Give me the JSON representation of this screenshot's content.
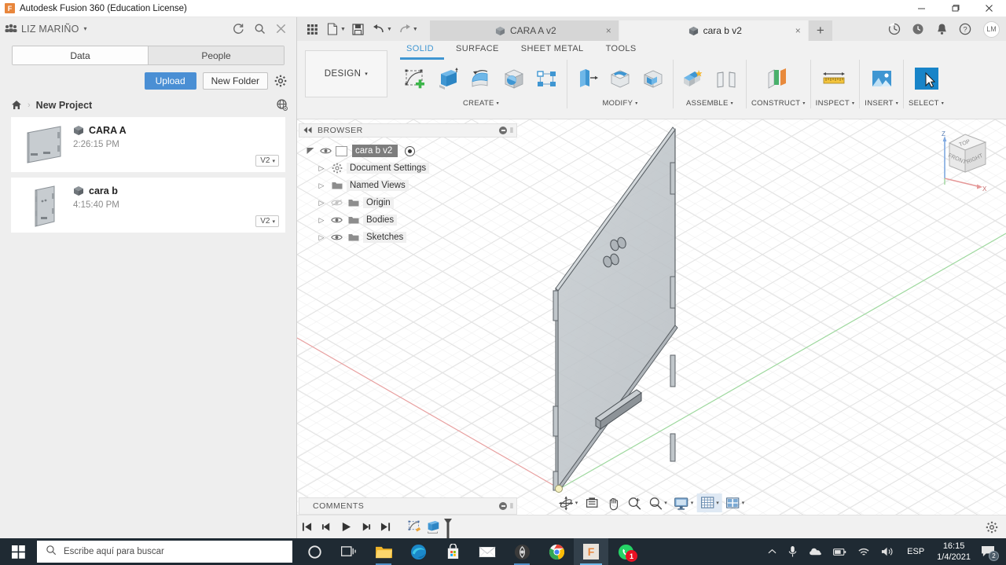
{
  "window": {
    "app_title": "Autodesk Fusion 360 (Education License)",
    "logo_letter": "F",
    "minimize": "minimize-icon",
    "maximize": "maximize-icon",
    "close": "close-icon"
  },
  "data_panel": {
    "user": "LIZ MARIÑO",
    "caret": "▾",
    "header_icons": [
      "refresh-icon",
      "search-icon",
      "close-icon"
    ],
    "tabs": [
      {
        "label": "Data",
        "active": true
      },
      {
        "label": "People",
        "active": false
      }
    ],
    "upload_label": "Upload",
    "new_folder_label": "New Folder",
    "settings_icon": "gear-icon",
    "breadcrumb": {
      "home": "home-icon",
      "separator": "›",
      "project": "New Project",
      "globe": "globe-icon"
    },
    "files": [
      {
        "name": "CARA A",
        "time": "2:26:15 PM",
        "version": "V2",
        "caret": "▾"
      },
      {
        "name": "cara b",
        "time": "4:15:40 PM",
        "version": "V2",
        "caret": "▾"
      }
    ]
  },
  "quick_access": {
    "buttons": [
      "grid-apps-icon",
      "new-file-icon",
      "save-icon",
      "undo-icon",
      "redo-icon"
    ],
    "doc_tabs": [
      {
        "label": "CARA A v2",
        "active": false,
        "close": "×"
      },
      {
        "label": "cara b v2",
        "active": true,
        "close": "×"
      }
    ],
    "new_tab": "+",
    "right_icons": [
      "job-status-icon",
      "recent-icon",
      "notifications-bell-icon",
      "help-icon"
    ],
    "avatar_initials": "LM"
  },
  "ribbon": {
    "workspace": "DESIGN",
    "workspace_caret": "▾",
    "tabs": [
      {
        "label": "SOLID",
        "active": true
      },
      {
        "label": "SURFACE",
        "active": false
      },
      {
        "label": "SHEET METAL",
        "active": false
      },
      {
        "label": "TOOLS",
        "active": false
      }
    ],
    "panels": [
      {
        "label": "CREATE",
        "caret": "▾",
        "icons": [
          "new-sketch-icon",
          "extrude-icon",
          "revolve-icon",
          "sphere-icon",
          "pattern-icon"
        ]
      },
      {
        "label": "MODIFY",
        "caret": "▾",
        "icons": [
          "press-pull-icon",
          "fillet-icon",
          "shell-icon"
        ]
      },
      {
        "label": "ASSEMBLE",
        "caret": "▾",
        "icons": [
          "new-component-icon",
          "joint-icon"
        ]
      },
      {
        "label": "CONSTRUCT",
        "caret": "▾",
        "icons": [
          "offset-plane-icon"
        ]
      },
      {
        "label": "INSPECT",
        "caret": "▾",
        "icons": [
          "measure-icon"
        ]
      },
      {
        "label": "INSERT",
        "caret": "▾",
        "icons": [
          "insert-image-icon"
        ]
      },
      {
        "label": "SELECT",
        "caret": "▾",
        "icons": [
          "select-cursor-icon"
        ]
      }
    ]
  },
  "browser": {
    "title": "BROWSER",
    "collapse_icon": "collapse-left-icon",
    "nodes": [
      {
        "label": "cara b v2",
        "root": true,
        "eye": true,
        "arrow": "◢"
      },
      {
        "label": "Document Settings",
        "icon": "gear-icon",
        "arrow": "▷"
      },
      {
        "label": "Named Views",
        "icon": "folder-icon",
        "arrow": "▷"
      },
      {
        "label": "Origin",
        "icon": "folder-icon",
        "arrow": "▷",
        "eye_off": true
      },
      {
        "label": "Bodies",
        "icon": "folder-icon",
        "arrow": "▷",
        "eye": true
      },
      {
        "label": "Sketches",
        "icon": "folder-icon",
        "arrow": "▷",
        "eye": true
      }
    ]
  },
  "comments": {
    "title": "COMMENTS"
  },
  "viewcube": {
    "faces": [
      "TOP",
      "FRONT",
      "RIGHT"
    ],
    "axes": {
      "z": "Z",
      "x": "X"
    }
  },
  "navbar": {
    "items": [
      {
        "name": "orbit-icon",
        "caret": "▾"
      },
      {
        "name": "look-at-icon",
        "caret": ""
      },
      {
        "name": "pan-hand-icon",
        "caret": ""
      },
      {
        "name": "zoom-window-icon",
        "caret": ""
      },
      {
        "name": "zoom-icon",
        "caret": "▾"
      },
      {
        "name": "display-settings-icon",
        "caret": "▾"
      },
      {
        "name": "grid-snaps-icon",
        "caret": "▾"
      },
      {
        "name": "viewports-icon",
        "caret": "▾"
      }
    ]
  },
  "timeline": {
    "controls": [
      "go-to-beginning-icon",
      "step-back-icon",
      "play-icon",
      "step-forward-icon",
      "go-to-end-icon"
    ],
    "features": [
      "sketch-feature-icon",
      "extrude-feature-icon"
    ],
    "marker": "timeline-marker",
    "settings_icon": "gear-icon"
  },
  "taskbar": {
    "start": "windows-start-icon",
    "search_placeholder": "Escribe aquí para buscar",
    "search_icon": "search-icon",
    "apps": [
      {
        "name": "cortana-icon",
        "badge": ""
      },
      {
        "name": "task-view-icon",
        "badge": ""
      },
      {
        "name": "file-explorer-icon",
        "badge": ""
      },
      {
        "name": "microsoft-edge-icon",
        "badge": ""
      },
      {
        "name": "microsoft-store-icon",
        "badge": ""
      },
      {
        "name": "mail-icon",
        "badge": ""
      },
      {
        "name": "media-app-icon",
        "badge": ""
      },
      {
        "name": "google-chrome-icon",
        "badge": ""
      },
      {
        "name": "fusion-360-icon",
        "badge": "",
        "active": true
      },
      {
        "name": "whatsapp-icon",
        "badge": "1"
      }
    ],
    "tray": {
      "chevron": "show-hidden-icons",
      "icons": [
        "microphone-icon",
        "onedrive-icon",
        "battery-icon",
        "wifi-icon",
        "volume-icon"
      ],
      "language": "ESP",
      "time": "16:15",
      "date": "1/4/2021",
      "notification_icon": "action-center-icon",
      "notification_count": "2"
    }
  },
  "colors": {
    "accent_blue": "#4a8fd4",
    "ribbon_active": "#3f96d2",
    "taskbar_bg": "#1f2a33",
    "model_face": "#c3c9cd",
    "badge_red": "#e81123"
  }
}
